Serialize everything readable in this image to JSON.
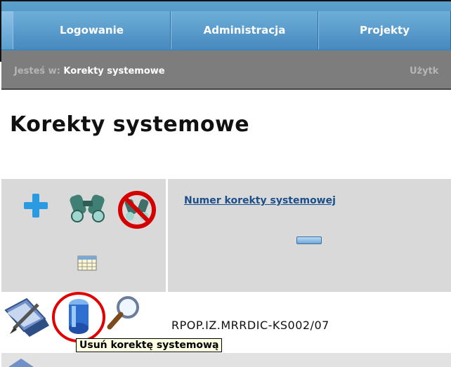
{
  "nav": {
    "tabs": [
      {
        "label": "Logowanie"
      },
      {
        "label": "Administracja"
      },
      {
        "label": "Projekty"
      }
    ]
  },
  "breadcrumb": {
    "prefix": "Jesteś w: ",
    "current": "Korekty systemowe",
    "right_text": "Użytk"
  },
  "page": {
    "title": "Korekty systemowe"
  },
  "grid": {
    "column_header": "Numer korekty systemowej",
    "rows": [
      {
        "number": "RPOP.IZ.MRRDIC-KS002/07"
      }
    ]
  },
  "tooltip": {
    "text": "Usuń korektę systemową"
  },
  "icons": {
    "header": [
      "add-icon",
      "binoculars-search-icon",
      "no-search-icon",
      "calendar-grid-icon"
    ],
    "row": [
      "edit-icon",
      "delete-icon",
      "view-icon"
    ]
  },
  "colors": {
    "nav_blue": "#4889bf",
    "crumb_gray": "#7d7d7d",
    "header_gray": "#d9d9d9",
    "link_blue": "#1b4f8a",
    "highlight_red": "#e00000",
    "tooltip_bg": "#ffffe1"
  }
}
